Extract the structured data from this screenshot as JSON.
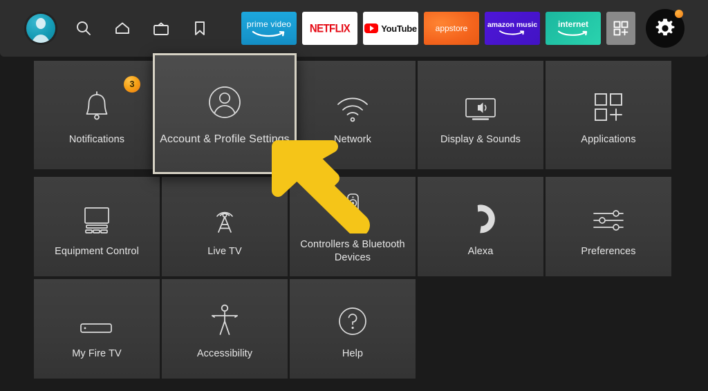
{
  "header": {
    "avatar": {
      "icon": "avatar-profile-icon"
    },
    "nav_icons": [
      {
        "name": "search-icon",
        "label": "Search"
      },
      {
        "name": "home-icon",
        "label": "Home"
      },
      {
        "name": "live-tv-icon",
        "label": "Live TV"
      },
      {
        "name": "bookmark-icon",
        "label": "Watchlist"
      }
    ],
    "apps": [
      {
        "name": "prime-video",
        "label": "prime video",
        "bg": "#1ca7dd"
      },
      {
        "name": "netflix",
        "label": "NETFLIX",
        "bg": "#ffffff",
        "fg": "#e50914"
      },
      {
        "name": "youtube",
        "label": "YouTube",
        "bg": "#ffffff",
        "fg": "#0f0f0f"
      },
      {
        "name": "appstore",
        "label": "appstore",
        "bg": "#f4641d"
      },
      {
        "name": "amazon-music",
        "label_strong": "amazon",
        "label": " music",
        "bg": "#4e16d8"
      },
      {
        "name": "internet",
        "label": "internet",
        "bg": "#2ad3ae"
      }
    ],
    "app_grid_button": {
      "name": "app-grid-add-button",
      "icon": "grid-plus-icon"
    },
    "settings_button": {
      "name": "settings-gear-button",
      "icon": "gear-icon",
      "has_badge": true,
      "badge_color": "#f08019"
    }
  },
  "grid": {
    "rows": [
      [
        {
          "id": "notifications",
          "label": "Notifications",
          "icon": "bell-icon",
          "badge": "3",
          "selected": false
        },
        {
          "id": "account-profile-settings",
          "label": "Account & Profile Settings",
          "icon": "person-circle-icon",
          "selected": true
        },
        {
          "id": "network",
          "label": "Network",
          "icon": "wifi-icon",
          "selected": false
        },
        {
          "id": "display-sounds",
          "label": "Display & Sounds",
          "icon": "tv-speaker-icon",
          "selected": false
        },
        {
          "id": "applications",
          "label": "Applications",
          "icon": "grid-plus-icon",
          "selected": false
        }
      ],
      [
        {
          "id": "equipment-control",
          "label": "Equipment Control",
          "icon": "monitor-devices-icon",
          "selected": false
        },
        {
          "id": "live-tv",
          "label": "Live TV",
          "icon": "broadcast-tower-icon",
          "selected": false
        },
        {
          "id": "controllers-bluetooth-devices",
          "label": "Controllers & Bluetooth Devices",
          "icon": "remote-control-icon",
          "selected": false
        },
        {
          "id": "alexa",
          "label": "Alexa",
          "icon": "alexa-ring-icon",
          "selected": false
        },
        {
          "id": "preferences",
          "label": "Preferences",
          "icon": "sliders-icon",
          "selected": false
        }
      ],
      [
        {
          "id": "my-fire-tv",
          "label": "My Fire TV",
          "icon": "fire-tv-stick-icon",
          "selected": false
        },
        {
          "id": "accessibility",
          "label": "Accessibility",
          "icon": "accessibility-person-icon",
          "selected": false
        },
        {
          "id": "help",
          "label": "Help",
          "icon": "question-circle-icon",
          "selected": false
        }
      ]
    ]
  },
  "annotation": {
    "arrow": {
      "name": "pointer-arrow",
      "color": "#F5C518",
      "direction": "up-left",
      "points_to": "account-profile-settings"
    }
  },
  "colors": {
    "page_bg": "#1b1b1b",
    "header_bg": "#2e2e2e",
    "tile_bg": "#3a3a3a",
    "tile_selected_border": "#d6d2c4",
    "text": "#e6e6e6",
    "accent_yellow": "#F5C518",
    "badge_orange": "#f08019"
  }
}
